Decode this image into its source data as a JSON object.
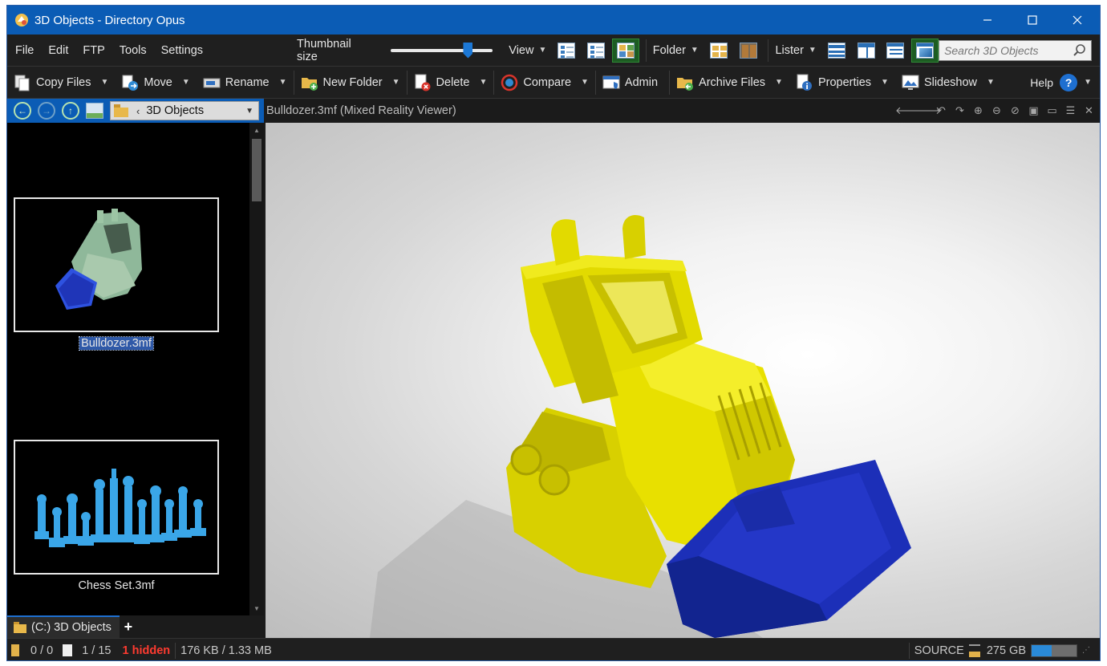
{
  "window": {
    "title": "3D Objects - Directory Opus",
    "minimize_icon": "minimize-icon",
    "maximize_icon": "maximize-icon",
    "close_icon": "close-icon"
  },
  "menu": {
    "items": [
      "File",
      "Edit",
      "FTP",
      "Tools",
      "Settings"
    ],
    "thumbnail_size_label": "Thumbnail size",
    "thumbnail_size_level": 0.78,
    "view_label": "View",
    "folder_label": "Folder",
    "lister_label": "Lister"
  },
  "search": {
    "placeholder": "Search 3D Objects",
    "icon": "magnifier-icon"
  },
  "toolbar": {
    "copy_files": "Copy Files",
    "move": "Move",
    "rename": "Rename",
    "new_folder": "New Folder",
    "delete": "Delete",
    "compare": "Compare",
    "admin": "Admin",
    "archive_files": "Archive Files",
    "properties": "Properties",
    "slideshow": "Slideshow",
    "help": "Help"
  },
  "location": {
    "path_label": "3D Objects"
  },
  "viewer": {
    "title": "Bulldozer.3mf (Mixed Reality Viewer)"
  },
  "files": [
    {
      "name": "Bulldozer.3mf",
      "selected": true
    },
    {
      "name": "Chess Set.3mf",
      "selected": false
    }
  ],
  "tabs": {
    "current": "(C:) 3D Objects",
    "add": "+"
  },
  "status": {
    "folders": "0 / 0",
    "files": "1 / 15",
    "hidden": "1 hidden",
    "size": "176 KB / 1.33 MB",
    "source": "SOURCE",
    "free_space": "275 GB",
    "free_space_fraction": 0.45
  },
  "colors": {
    "titlebar": "#0b5cb5",
    "accent": "#1e6fd0",
    "bulldozer_body": "#e8e000",
    "bulldozer_blade": "#1c2fb8",
    "chess_pieces": "#3aa6e8",
    "hidden_text": "#ff3b30"
  }
}
